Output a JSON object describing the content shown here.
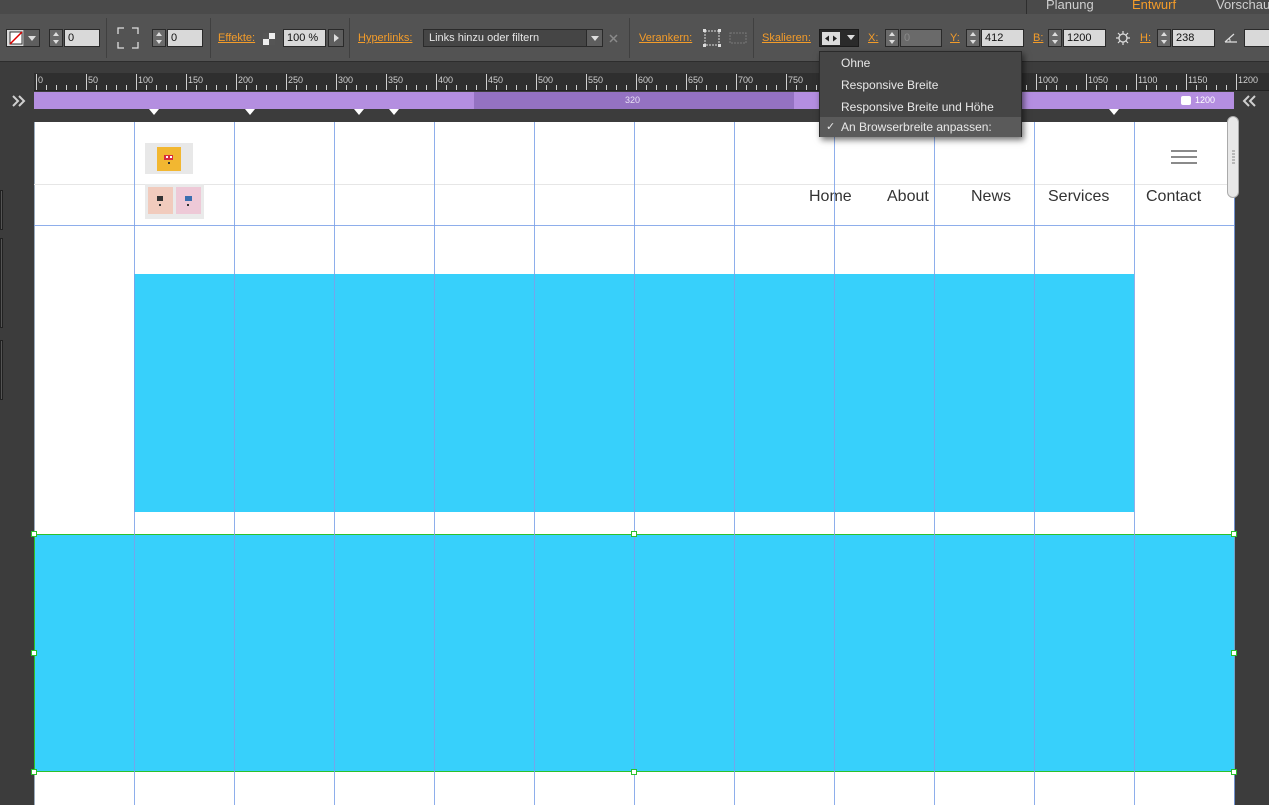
{
  "modes": [
    "Planung",
    "Entwurf",
    "Vorschau"
  ],
  "active_mode": "Entwurf",
  "toolbar": {
    "stroke_value": "0",
    "corner_value": "0",
    "effects_label": "Effekte:",
    "opacity_value": "100 %",
    "hyperlinks_label": "Hyperlinks:",
    "hyperlinks_value": "Links hinzu oder filtern",
    "anchor_label": "Verankern:",
    "scale_label": "Skalieren:",
    "x_label": "X:",
    "x_value": "0",
    "y_label": "Y:",
    "y_value": "412",
    "w_label": "B:",
    "w_value": "1200",
    "h_label": "H:",
    "h_value": "238"
  },
  "ruler": {
    "labels": [
      "0",
      "50",
      "100",
      "150",
      "200",
      "250",
      "300",
      "350",
      "400",
      "450",
      "500",
      "550",
      "600",
      "650",
      "700",
      "750",
      "800",
      "850",
      "900",
      "950",
      "1000",
      "1050",
      "1100",
      "1150",
      "1200"
    ]
  },
  "breakpoints": {
    "center_label": "320",
    "end_label": "1200"
  },
  "scale_menu": {
    "items": [
      "Ohne",
      "Responsive Breite",
      "Responsive Breite und Höhe",
      "An Browserbreite anpassen:"
    ],
    "selected_index": 3
  },
  "site_nav": {
    "items": [
      "Home",
      "About",
      "News",
      "Services",
      "Contact"
    ]
  },
  "colors": {
    "accent": "#f39c2a",
    "breakpoint_bar": "#b48ee0",
    "content_blue": "#37d0fb",
    "selection_green": "#2bc12b",
    "guide_blue": "#7aa0e8"
  },
  "icons": {
    "hamburger": "hamburger-menu-icon",
    "collapse_left": "double-chevron-right-icon",
    "collapse_right": "double-chevron-left-icon"
  }
}
